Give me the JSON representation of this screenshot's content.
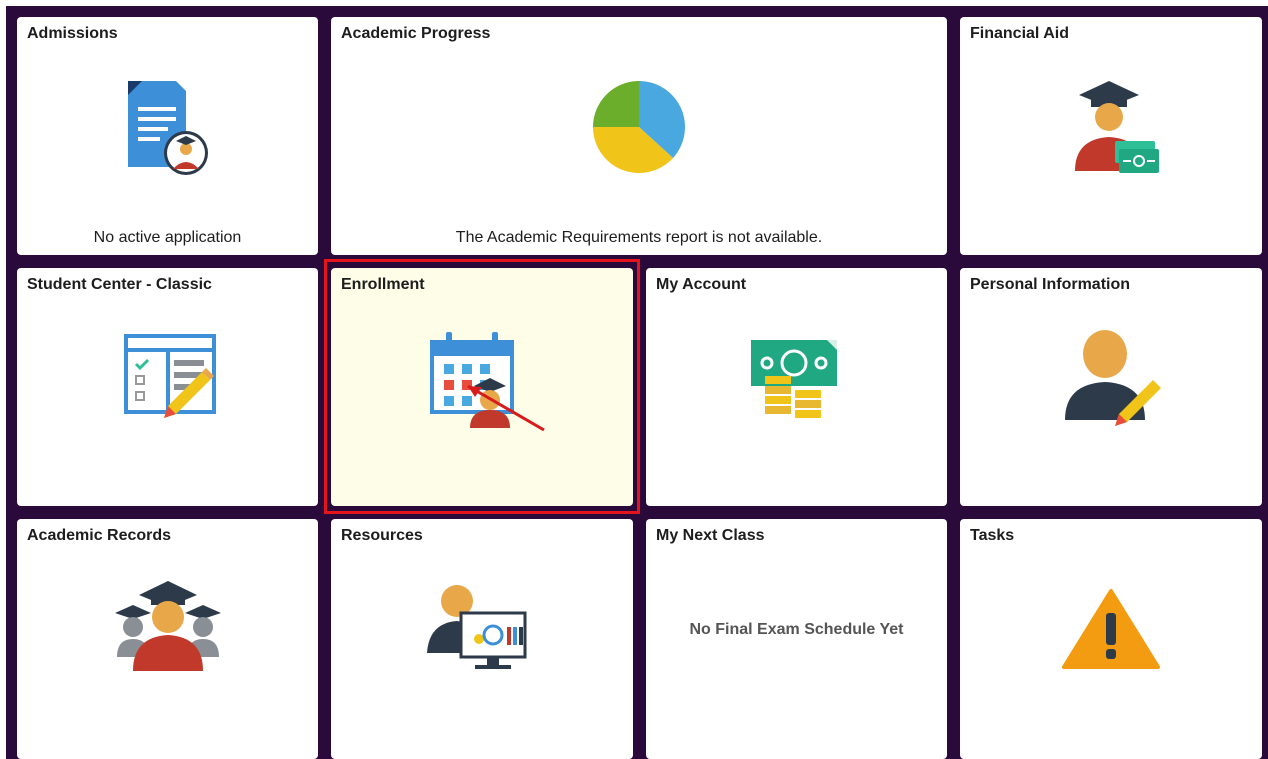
{
  "tiles": {
    "admissions": {
      "title": "Admissions",
      "footer": "No active application"
    },
    "academic_progress": {
      "title": "Academic Progress",
      "footer": "The Academic Requirements report is not available."
    },
    "financial_aid": {
      "title": "Financial Aid"
    },
    "student_center": {
      "title": "Student Center - Classic"
    },
    "enrollment": {
      "title": "Enrollment"
    },
    "my_account": {
      "title": "My Account"
    },
    "personal_information": {
      "title": "Personal Information"
    },
    "academic_records": {
      "title": "Academic Records"
    },
    "resources": {
      "title": "Resources"
    },
    "my_next_class": {
      "title": "My Next Class",
      "message": "No Final Exam Schedule Yet"
    },
    "tasks": {
      "title": "Tasks"
    }
  },
  "icons": {
    "admissions": "document-student-icon",
    "academic_progress": "pie-chart-icon",
    "financial_aid": "graduate-money-icon",
    "student_center": "checklist-edit-icon",
    "enrollment": "calendar-student-icon",
    "my_account": "money-coins-icon",
    "personal_information": "person-edit-icon",
    "academic_records": "graduates-group-icon",
    "resources": "presenter-screen-icon",
    "tasks": "warning-icon"
  },
  "colors": {
    "background": "#2a0a3a",
    "tile": "#ffffff",
    "enrollment_tile": "#fefde8",
    "highlight": "#e4141c"
  }
}
